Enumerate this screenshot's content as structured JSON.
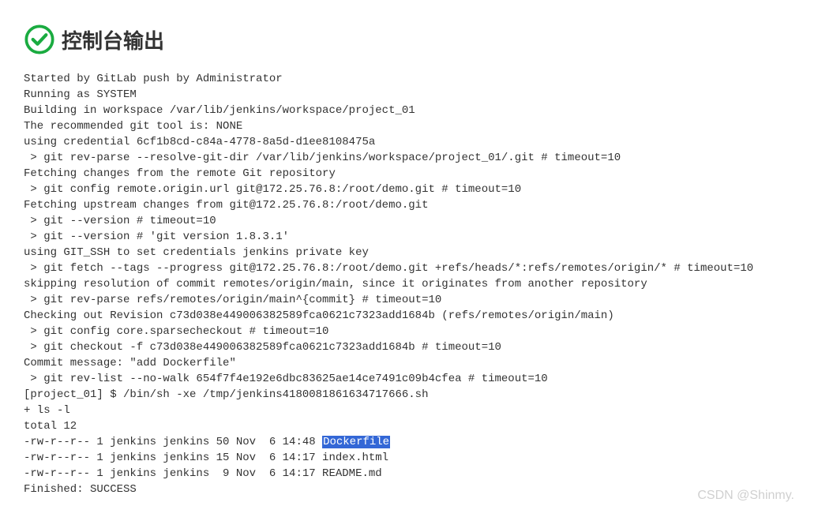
{
  "header": {
    "title": "控制台输出",
    "icon": "success-check"
  },
  "console": {
    "lines": [
      {
        "text": "Started by GitLab push by Administrator"
      },
      {
        "text": "Running as SYSTEM"
      },
      {
        "text": "Building in workspace /var/lib/jenkins/workspace/project_01"
      },
      {
        "text": "The recommended git tool is: NONE"
      },
      {
        "text": "using credential 6cf1b8cd-c84a-4778-8a5d-d1ee8108475a"
      },
      {
        "text": " > git rev-parse --resolve-git-dir /var/lib/jenkins/workspace/project_01/.git # timeout=10"
      },
      {
        "text": "Fetching changes from the remote Git repository"
      },
      {
        "text": " > git config remote.origin.url git@172.25.76.8:/root/demo.git # timeout=10"
      },
      {
        "text": "Fetching upstream changes from git@172.25.76.8:/root/demo.git"
      },
      {
        "text": " > git --version # timeout=10"
      },
      {
        "text": " > git --version # 'git version 1.8.3.1'"
      },
      {
        "text": "using GIT_SSH to set credentials jenkins private key"
      },
      {
        "text": " > git fetch --tags --progress git@172.25.76.8:/root/demo.git +refs/heads/*:refs/remotes/origin/* # timeout=10"
      },
      {
        "text": "skipping resolution of commit remotes/origin/main, since it originates from another repository"
      },
      {
        "text": " > git rev-parse refs/remotes/origin/main^{commit} # timeout=10"
      },
      {
        "text": "Checking out Revision c73d038e449006382589fca0621c7323add1684b (refs/remotes/origin/main)"
      },
      {
        "text": " > git config core.sparsecheckout # timeout=10"
      },
      {
        "text": " > git checkout -f c73d038e449006382589fca0621c7323add1684b # timeout=10"
      },
      {
        "text": "Commit message: \"add Dockerfile\""
      },
      {
        "text": " > git rev-list --no-walk 654f7f4e192e6dbc83625ae14ce7491c09b4cfea # timeout=10"
      },
      {
        "text": "[project_01] $ /bin/sh -xe /tmp/jenkins4180081861634717666.sh"
      },
      {
        "text": "+ ls -l"
      },
      {
        "text": "total 12"
      },
      {
        "prefix": "-rw-r--r-- 1 jenkins jenkins 50 Nov  6 14:48 ",
        "highlighted": "Dockerfile"
      },
      {
        "text": "-rw-r--r-- 1 jenkins jenkins 15 Nov  6 14:17 index.html"
      },
      {
        "text": "-rw-r--r-- 1 jenkins jenkins  9 Nov  6 14:17 README.md"
      },
      {
        "text": "Finished: SUCCESS"
      }
    ]
  },
  "watermark": "CSDN @Shinmy."
}
